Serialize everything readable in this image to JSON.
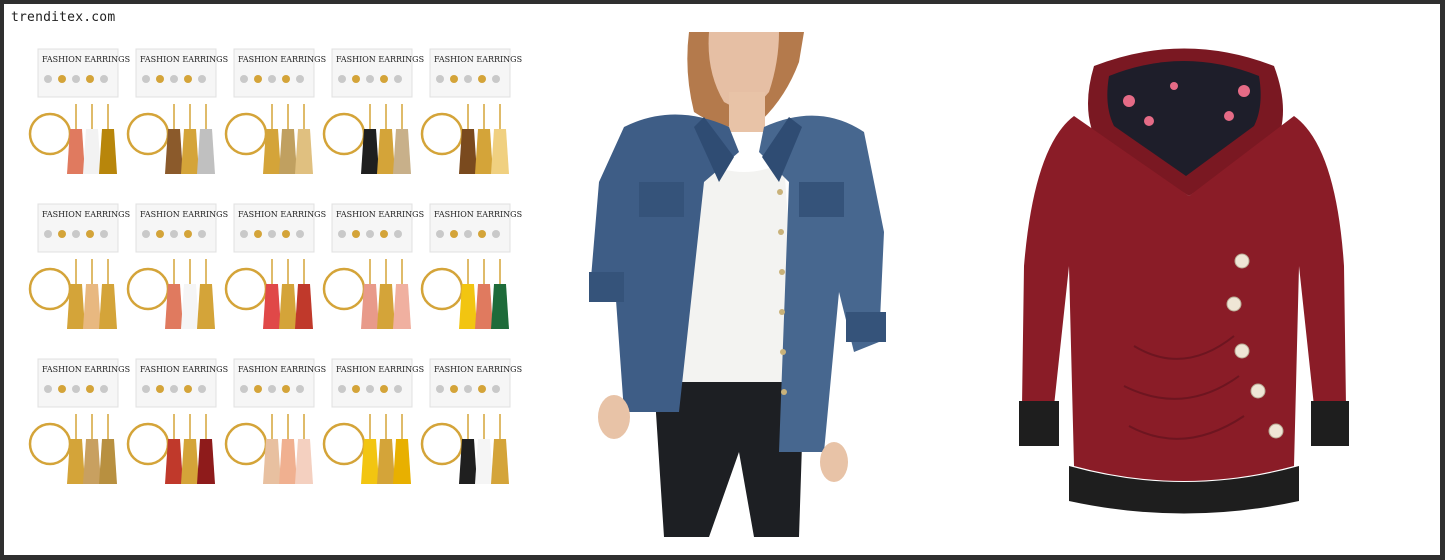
{
  "site": {
    "watermark": "trenditex.com"
  },
  "earrings": {
    "card_label": "FASHION EARRINGS"
  },
  "colors": {
    "background_frame": "#2f2f2f",
    "page": "#ffffff",
    "denim": "#3e5d86",
    "hoodie": "#8a1c27",
    "gold": "#d4a439"
  },
  "products": [
    {
      "name": "earrings-set",
      "description_icon": "earrings-image"
    },
    {
      "name": "denim-jacket",
      "description_icon": "jacket-image"
    },
    {
      "name": "burgundy-hoodie",
      "description_icon": "hoodie-image"
    }
  ]
}
